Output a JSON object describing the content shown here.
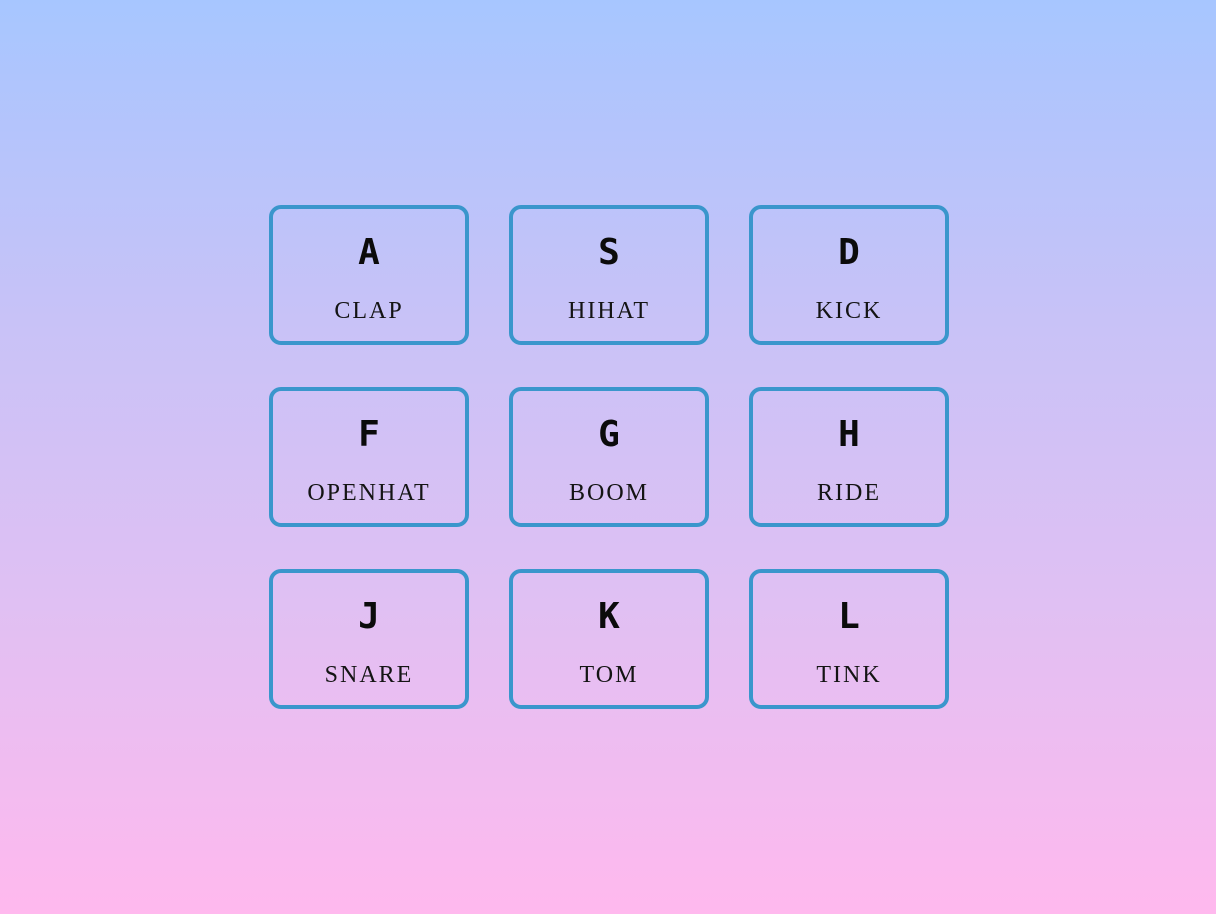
{
  "pads": [
    {
      "key": "A",
      "sound": "CLAP"
    },
    {
      "key": "S",
      "sound": "HIHAT"
    },
    {
      "key": "D",
      "sound": "KICK"
    },
    {
      "key": "F",
      "sound": "OPENHAT"
    },
    {
      "key": "G",
      "sound": "BOOM"
    },
    {
      "key": "H",
      "sound": "RIDE"
    },
    {
      "key": "J",
      "sound": "SNARE"
    },
    {
      "key": "K",
      "sound": "TOM"
    },
    {
      "key": "L",
      "sound": "TINK"
    }
  ],
  "colors": {
    "pad_border": "#3a96cc",
    "background_top": "#a7c6ff",
    "background_bottom": "#ffb9ee",
    "text": "#0b0b0b"
  }
}
